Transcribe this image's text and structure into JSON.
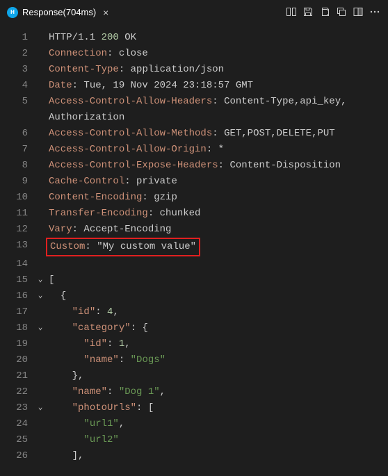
{
  "tab": {
    "title": "Response(704ms)"
  },
  "lines": [
    {
      "num": 1,
      "fold": "",
      "indent": "",
      "tokens": [
        [
          "tok-http",
          "HTTP/1.1 "
        ],
        [
          "tok-status",
          "200"
        ],
        [
          "tok-http",
          " OK"
        ]
      ]
    },
    {
      "num": 2,
      "fold": "",
      "indent": "",
      "tokens": [
        [
          "tok-header",
          "Connection"
        ],
        [
          "tok-punct",
          ": "
        ],
        [
          "tok-plain",
          "close"
        ]
      ]
    },
    {
      "num": 3,
      "fold": "",
      "indent": "",
      "tokens": [
        [
          "tok-header",
          "Content-Type"
        ],
        [
          "tok-punct",
          ": "
        ],
        [
          "tok-plain",
          "application/json"
        ]
      ]
    },
    {
      "num": 4,
      "fold": "",
      "indent": "",
      "tokens": [
        [
          "tok-header",
          "Date"
        ],
        [
          "tok-punct",
          ": "
        ],
        [
          "tok-plain",
          "Tue, 19 Nov 2024 23:18:57 GMT"
        ]
      ]
    },
    {
      "num": 5,
      "fold": "",
      "indent": "",
      "tokens": [
        [
          "tok-header",
          "Access-Control-Allow-Headers"
        ],
        [
          "tok-punct",
          ": "
        ],
        [
          "tok-plain",
          "Content-Type,api_key,"
        ]
      ]
    },
    {
      "num": "",
      "fold": "",
      "indent": "",
      "tokens": [
        [
          "tok-plain",
          "Authorization"
        ]
      ]
    },
    {
      "num": 6,
      "fold": "",
      "indent": "",
      "tokens": [
        [
          "tok-header",
          "Access-Control-Allow-Methods"
        ],
        [
          "tok-punct",
          ": "
        ],
        [
          "tok-plain",
          "GET,POST,DELETE,PUT"
        ]
      ]
    },
    {
      "num": 7,
      "fold": "",
      "indent": "",
      "tokens": [
        [
          "tok-header",
          "Access-Control-Allow-Origin"
        ],
        [
          "tok-punct",
          ": "
        ],
        [
          "tok-plain",
          "*"
        ]
      ]
    },
    {
      "num": 8,
      "fold": "",
      "indent": "",
      "tokens": [
        [
          "tok-header",
          "Access-Control-Expose-Headers"
        ],
        [
          "tok-punct",
          ": "
        ],
        [
          "tok-plain",
          "Content-Disposition"
        ]
      ]
    },
    {
      "num": 9,
      "fold": "",
      "indent": "",
      "tokens": [
        [
          "tok-header",
          "Cache-Control"
        ],
        [
          "tok-punct",
          ": "
        ],
        [
          "tok-plain",
          "private"
        ]
      ]
    },
    {
      "num": 10,
      "fold": "",
      "indent": "",
      "tokens": [
        [
          "tok-header",
          "Content-Encoding"
        ],
        [
          "tok-punct",
          ": "
        ],
        [
          "tok-plain",
          "gzip"
        ]
      ]
    },
    {
      "num": 11,
      "fold": "",
      "indent": "",
      "tokens": [
        [
          "tok-header",
          "Transfer-Encoding"
        ],
        [
          "tok-punct",
          ": "
        ],
        [
          "tok-plain",
          "chunked"
        ]
      ]
    },
    {
      "num": 12,
      "fold": "",
      "indent": "",
      "tokens": [
        [
          "tok-header",
          "Vary"
        ],
        [
          "tok-punct",
          ": "
        ],
        [
          "tok-plain",
          "Accept-Encoding"
        ]
      ]
    },
    {
      "num": 13,
      "fold": "",
      "indent": "",
      "highlight": true,
      "tokens": [
        [
          "tok-header",
          "Custom"
        ],
        [
          "tok-punct",
          ": "
        ],
        [
          "tok-plain",
          "\"My custom value\""
        ]
      ]
    },
    {
      "num": 14,
      "fold": "",
      "indent": "",
      "tokens": []
    },
    {
      "num": 15,
      "fold": "⌄",
      "indent": "",
      "tokens": [
        [
          "tok-brace",
          "["
        ]
      ]
    },
    {
      "num": 16,
      "fold": "⌄",
      "indent": "  ",
      "tokens": [
        [
          "tok-brace",
          "{"
        ]
      ]
    },
    {
      "num": 17,
      "fold": "",
      "indent": "    ",
      "tokens": [
        [
          "tok-key",
          "\"id\""
        ],
        [
          "tok-punct",
          ": "
        ],
        [
          "tok-num",
          "4"
        ],
        [
          "tok-punct",
          ","
        ]
      ]
    },
    {
      "num": 18,
      "fold": "⌄",
      "indent": "    ",
      "tokens": [
        [
          "tok-key",
          "\"category\""
        ],
        [
          "tok-punct",
          ": "
        ],
        [
          "tok-brace",
          "{"
        ]
      ]
    },
    {
      "num": 19,
      "fold": "",
      "indent": "      ",
      "tokens": [
        [
          "tok-key",
          "\"id\""
        ],
        [
          "tok-punct",
          ": "
        ],
        [
          "tok-num",
          "1"
        ],
        [
          "tok-punct",
          ","
        ]
      ]
    },
    {
      "num": 20,
      "fold": "",
      "indent": "      ",
      "tokens": [
        [
          "tok-key",
          "\"name\""
        ],
        [
          "tok-punct",
          ": "
        ],
        [
          "tok-string",
          "\"Dogs\""
        ]
      ]
    },
    {
      "num": 21,
      "fold": "",
      "indent": "    ",
      "tokens": [
        [
          "tok-brace",
          "}"
        ],
        [
          "tok-punct",
          ","
        ]
      ]
    },
    {
      "num": 22,
      "fold": "",
      "indent": "    ",
      "tokens": [
        [
          "tok-key",
          "\"name\""
        ],
        [
          "tok-punct",
          ": "
        ],
        [
          "tok-string",
          "\"Dog 1\""
        ],
        [
          "tok-punct",
          ","
        ]
      ]
    },
    {
      "num": 23,
      "fold": "⌄",
      "indent": "    ",
      "tokens": [
        [
          "tok-key",
          "\"photoUrls\""
        ],
        [
          "tok-punct",
          ": "
        ],
        [
          "tok-brace",
          "["
        ]
      ]
    },
    {
      "num": 24,
      "fold": "",
      "indent": "      ",
      "tokens": [
        [
          "tok-string",
          "\"url1\""
        ],
        [
          "tok-punct",
          ","
        ]
      ]
    },
    {
      "num": 25,
      "fold": "",
      "indent": "      ",
      "tokens": [
        [
          "tok-string",
          "\"url2\""
        ]
      ]
    },
    {
      "num": 26,
      "fold": "",
      "indent": "    ",
      "tokens": [
        [
          "tok-brace",
          "]"
        ],
        [
          "tok-punct",
          ","
        ]
      ]
    }
  ]
}
